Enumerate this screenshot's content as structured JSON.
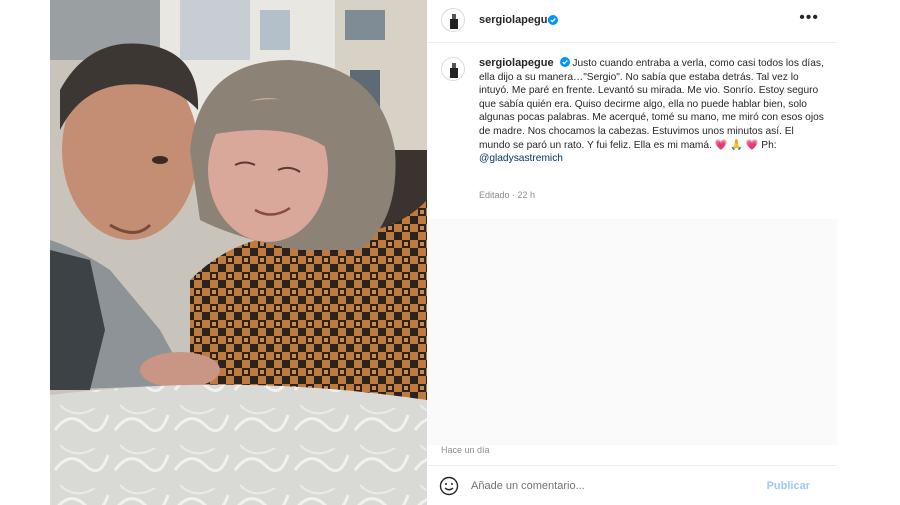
{
  "post": {
    "username": "sergiolapegue",
    "more_icon": "more-horizontal-icon",
    "verified_icon": "verified-badge-icon",
    "caption_text": "Justo cuando entraba a verla, como casi todos los días, ella dijo a su manera…\"Sergio\". No sabía que estaba detrás. Tal vez lo intuyó. Me paré en frente. Levantó su mirada. Me vio. Sonrío. Estoy seguro que sabía quién era. Quiso decirme algo, ella no puede hablar bien, solo algunas pocas palabras. Me acerqué, tomé su mano, me miró con esos ojos de madre. Nos chocamos la cabezas. Estuvimos unos minutos así. El mundo se paró un rato. Y fui feliz. Ella es mi mamá. ",
    "caption_emojis": "💗 🙏 💗",
    "caption_credit": " Ph:",
    "caption_mention": "@gladysastremich",
    "edited_label": "Editado",
    "edited_time": "22 h",
    "post_date": "Hace un día"
  },
  "comment": {
    "placeholder": "Añade un comentario...",
    "emoji_icon": "emoji-smile-icon",
    "post_label": "Publicar",
    "post_color": "#9ccbf6"
  },
  "colors": {
    "link": "#00376b",
    "verified": "#0095f6",
    "muted": "#8e8e8e"
  }
}
